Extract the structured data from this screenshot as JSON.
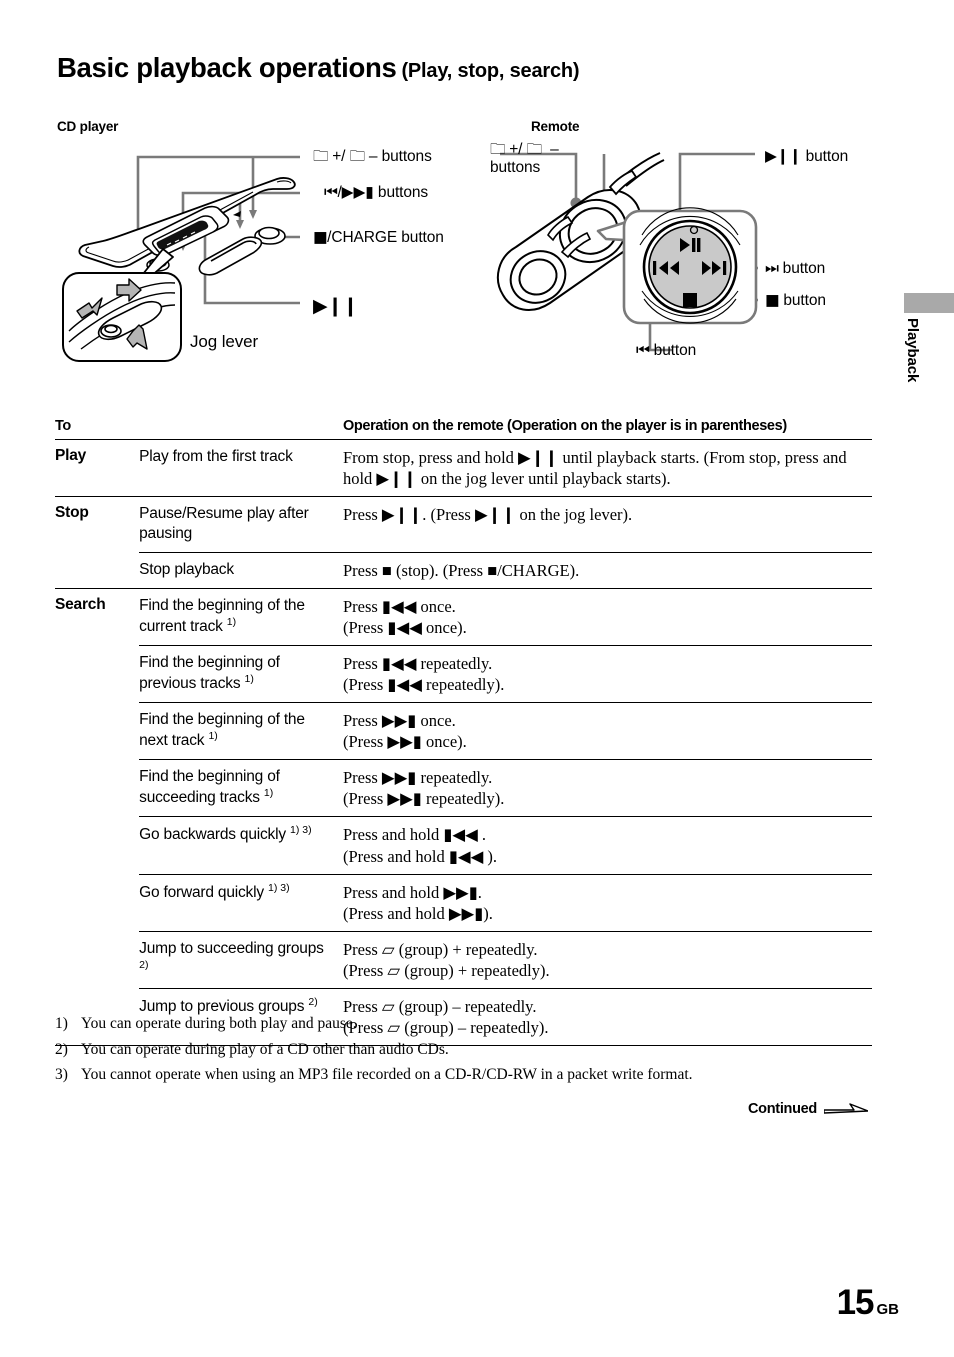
{
  "title": {
    "main": "Basic playback operations",
    "sub": "(Play, stop, search)"
  },
  "captions": {
    "cd_player": "CD player",
    "remote": "Remote"
  },
  "side_tab": {
    "label": "Playback"
  },
  "cd_player_labels": {
    "group_buttons_line1": "+/",
    "group_buttons_line2": "– buttons",
    "group_buttons_full": "▱ +/ ▱ – buttons",
    "skip_buttons": "/▶▶▮ buttons",
    "skip_prefix": "▮◀◀",
    "stop_charge_button": "/CHARGE button",
    "play_pause": "▶❙❙",
    "jog_lever": "Jog lever"
  },
  "remote_labels": {
    "group_buttons_line1": "+/",
    "group_buttons_line2": "buttons",
    "play_pause_button": "button",
    "next_button": "button",
    "stop_button": "button",
    "prev_button": "button"
  },
  "table": {
    "header": {
      "col1": "To",
      "col2": "",
      "col3": "Operation on the remote (Operation on the player is in parentheses)"
    },
    "rows": [
      {
        "category": "Play",
        "desc": "Play from the first track",
        "desc_sup": "",
        "op_lines": [
          "From stop, press and hold ▶❙❙ until playback starts. (From stop, press and hold ▶❙❙ on the jog lever until playback starts)."
        ],
        "group": true
      },
      {
        "category": "Stop",
        "desc": "Pause/Resume play after pausing",
        "desc_sup": "",
        "op_lines": [
          "Press ▶❙❙. (Press ▶❙❙ on the jog lever)."
        ],
        "group": true
      },
      {
        "category": "",
        "desc": "Stop playback",
        "desc_sup": "",
        "op_lines": [
          "Press ■ (stop). (Press ■/CHARGE)."
        ],
        "group": false
      },
      {
        "category": "Search",
        "desc": "Find the beginning of the current track",
        "desc_sup": "1)",
        "op_lines": [
          "Press ▮◀◀ once.",
          "(Press ▮◀◀ once)."
        ],
        "group": true
      },
      {
        "category": "",
        "desc": "Find the beginning of previous tracks",
        "desc_sup": "1)",
        "op_lines": [
          "Press ▮◀◀ repeatedly.",
          "(Press ▮◀◀ repeatedly)."
        ],
        "group": false
      },
      {
        "category": "",
        "desc": "Find the beginning of the next track",
        "desc_sup": "1)",
        "op_lines": [
          "Press ▶▶▮ once.",
          "(Press ▶▶▮ once)."
        ],
        "group": false
      },
      {
        "category": "",
        "desc": "Find the beginning of succeeding tracks",
        "desc_sup": "1)",
        "op_lines": [
          "Press ▶▶▮ repeatedly.",
          "(Press ▶▶▮ repeatedly)."
        ],
        "group": false
      },
      {
        "category": "",
        "desc": "Go backwards quickly",
        "desc_sup": "1) 3)",
        "op_lines": [
          "Press and hold ▮◀◀ .",
          "(Press and hold ▮◀◀ )."
        ],
        "group": false
      },
      {
        "category": "",
        "desc": "Go forward quickly",
        "desc_sup": "1) 3)",
        "op_lines": [
          "Press and hold ▶▶▮.",
          "(Press and hold ▶▶▮)."
        ],
        "group": false
      },
      {
        "category": "",
        "desc": "Jump to succeeding groups",
        "desc_sup": "2)",
        "op_lines": [
          "Press ▱ (group) + repeatedly.",
          "(Press ▱ (group) + repeatedly)."
        ],
        "group": false
      },
      {
        "category": "",
        "desc": "Jump to previous groups",
        "desc_sup": "2)",
        "op_lines": [
          "Press ▱ (group) – repeatedly.",
          "(Press ▱ (group) – repeatedly)."
        ],
        "group": false
      }
    ]
  },
  "footnotes": [
    {
      "num": "1)",
      "text": "You can operate during both play and pause."
    },
    {
      "num": "2)",
      "text": "You can operate during play of a CD other than audio CDs."
    },
    {
      "num": "3)",
      "text": "You cannot operate when using an MP3 file recorded on a CD-R/CD-RW in a packet write format."
    }
  ],
  "continued": {
    "label": "Continued"
  },
  "page": {
    "number": "15",
    "region": "GB"
  },
  "colors": {
    "text": "#000000",
    "tab_gray": "#a9a9a9",
    "leader_gray": "#7a7a7a",
    "dial_gray": "#c9c9c9"
  }
}
